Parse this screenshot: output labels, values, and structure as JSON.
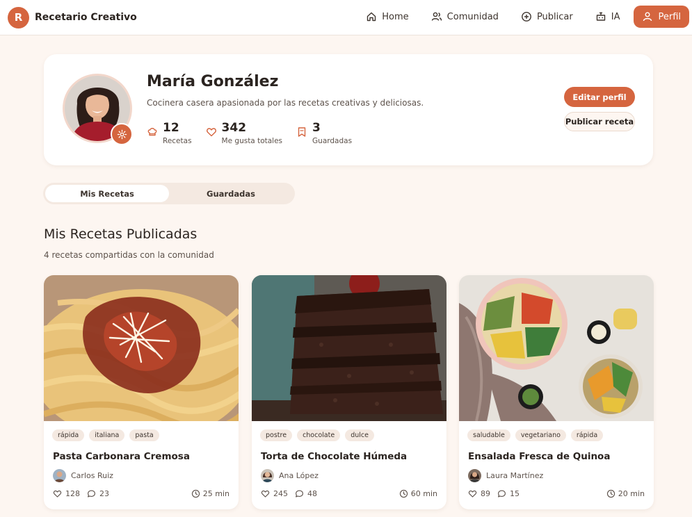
{
  "brand": {
    "logo_letter": "R",
    "name": "Recetario Creativo"
  },
  "nav": {
    "items": [
      {
        "label": "Home",
        "icon": "home-icon"
      },
      {
        "label": "Comunidad",
        "icon": "users-icon"
      },
      {
        "label": "Publicar",
        "icon": "plus-circle-icon"
      },
      {
        "label": "IA",
        "icon": "robot-icon"
      },
      {
        "label": "Perfil",
        "icon": "user-icon",
        "active": true
      }
    ]
  },
  "profile": {
    "name": "María González",
    "bio": "Cocinera casera apasionada por las recetas creativas y deliciosas.",
    "stats": [
      {
        "value": "12",
        "label": "Recetas",
        "icon": "chef-hat-icon"
      },
      {
        "value": "342",
        "label": "Me gusta totales",
        "icon": "heart-icon"
      },
      {
        "value": "3",
        "label": "Guardadas",
        "icon": "bookmark-icon"
      }
    ],
    "edit_label": "Editar perfil",
    "publish_label": "Publicar receta"
  },
  "tabs": [
    {
      "label": "Mis Recetas",
      "active": true
    },
    {
      "label": "Guardadas",
      "active": false
    }
  ],
  "section": {
    "title": "Mis Recetas Publicadas",
    "subtitle": "4 recetas compartidas con la comunidad"
  },
  "recipes": [
    {
      "tags": [
        "rápida",
        "italiana",
        "pasta"
      ],
      "title": "Pasta Carbonara Cremosa",
      "author": "Carlos Ruiz",
      "likes": "128",
      "comments": "23",
      "time": "25 min"
    },
    {
      "tags": [
        "postre",
        "chocolate",
        "dulce"
      ],
      "title": "Torta de Chocolate Húmeda",
      "author": "Ana López",
      "likes": "245",
      "comments": "48",
      "time": "60 min"
    },
    {
      "tags": [
        "saludable",
        "vegetariano",
        "rápida"
      ],
      "title": "Ensalada Fresca de Quinoa",
      "author": "Laura Martínez",
      "likes": "89",
      "comments": "15",
      "time": "20 min"
    }
  ],
  "colors": {
    "accent": "#d5653f",
    "background": "#fdf6f1",
    "card": "#ffffff",
    "tag_bg": "#f4e9e1"
  }
}
